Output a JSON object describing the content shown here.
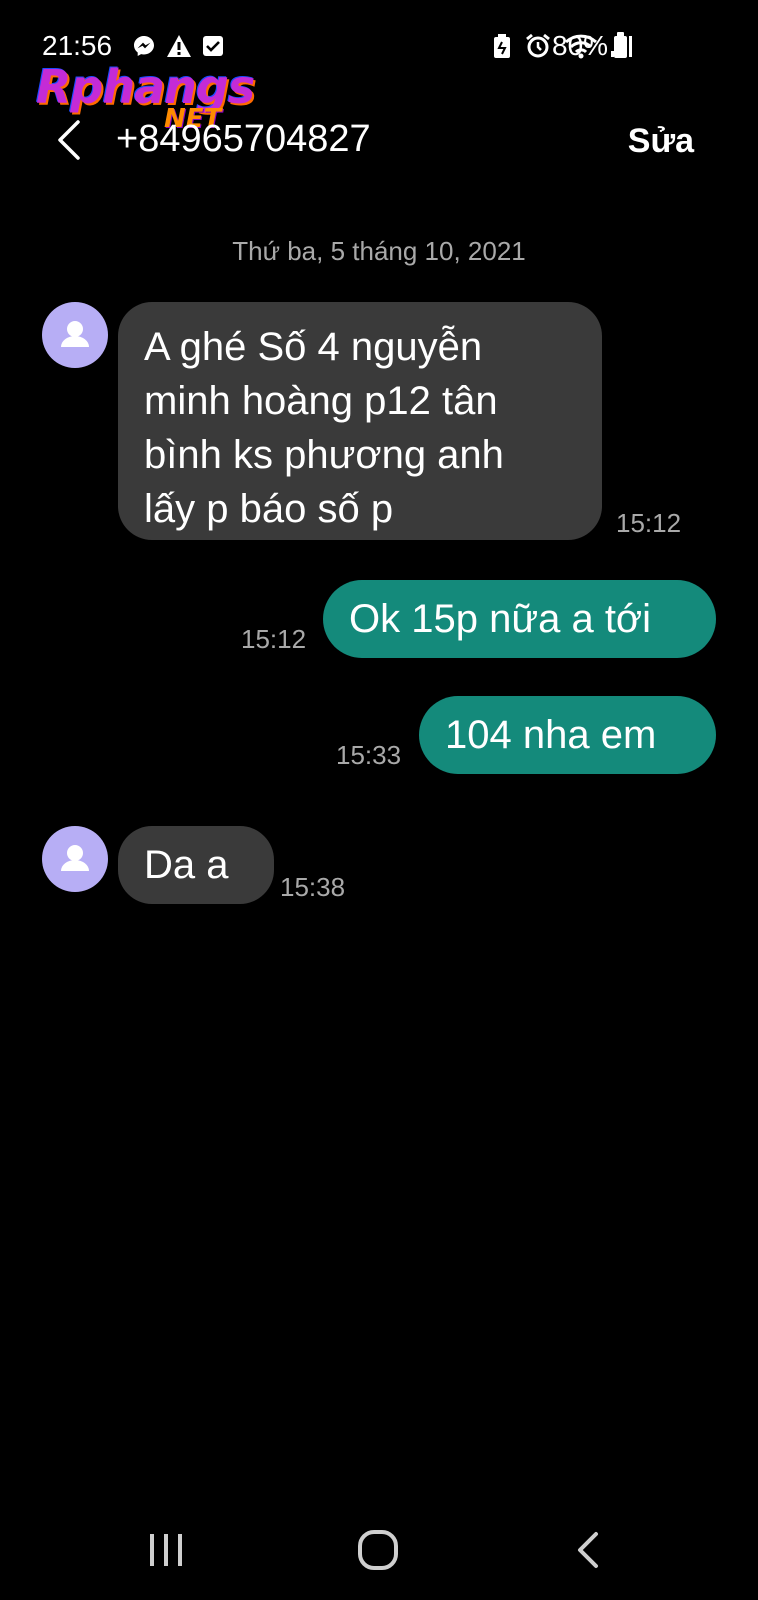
{
  "status_bar": {
    "time": "21:56",
    "battery_percent": "80%",
    "left_icons": [
      "messenger-icon",
      "alert-icon",
      "check-icon"
    ],
    "right_icons": [
      "battery-saver-icon",
      "alarm-icon",
      "wifi-icon",
      "signal-icon",
      "battery-icon"
    ]
  },
  "watermark": {
    "main": "Rphangs",
    "sub": "NET"
  },
  "header": {
    "title": "+84965704827",
    "edit_label": "Sửa",
    "back_icon": "chevron-left-icon"
  },
  "conversation": {
    "date_separator": "Thứ ba, 5 tháng 10, 2021",
    "messages": [
      {
        "direction": "in",
        "text": "A ghé Số 4 nguyễn\nminh hoàng p12 tân\nbình ks phương anh\nlấy p báo số p",
        "time": "15:12"
      },
      {
        "direction": "out",
        "text": "Ok 15p nữa a tới",
        "time": "15:12"
      },
      {
        "direction": "out",
        "text": "104 nha em",
        "time": "15:33"
      },
      {
        "direction": "in",
        "text": "Da a",
        "time": "15:38"
      }
    ]
  },
  "nav_bar": {
    "icons": [
      "recent-apps-icon",
      "home-icon",
      "back-nav-icon"
    ]
  },
  "colors": {
    "background": "#000000",
    "incoming_bubble": "#3a3a3a",
    "outgoing_bubble": "#148a7b",
    "avatar": "#b7aef5",
    "timestamp": "#a9a9a9"
  }
}
